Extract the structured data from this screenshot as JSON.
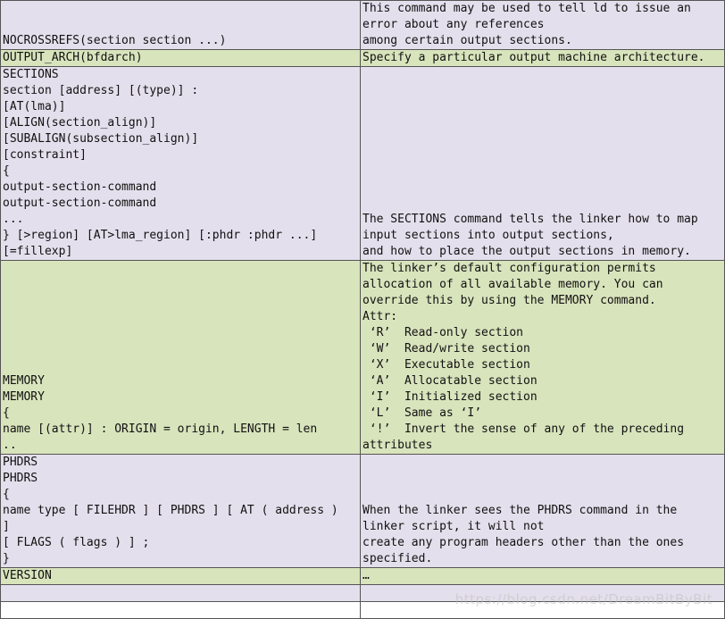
{
  "rows": [
    {
      "style": "lav",
      "height": 54,
      "left": [
        "NOCROSSREFS(section section ...)"
      ],
      "right": [
        "This command may be used to tell ld to issue an",
        "error about any references",
        "among certain output sections."
      ]
    },
    {
      "style": "grn",
      "height": 18,
      "left": [
        "OUTPUT_ARCH(bfdarch)"
      ],
      "right": [
        "Specify a particular output machine architecture."
      ]
    },
    {
      "style": "lav",
      "height": 216,
      "left": [
        "SECTIONS",
        "section [address] [(type)] :",
        "[AT(lma)]",
        "[ALIGN(section_align)]",
        "[SUBALIGN(subsection_align)]",
        "[constraint]",
        "{",
        "output-section-command",
        "output-section-command",
        "...",
        "} [>region] [AT>lma_region] [:phdr :phdr ...]",
        "[=fillexp]"
      ],
      "right": [
        "The SECTIONS command tells the linker how to map",
        "input sections into output sections,",
        "and how to place the output sections in memory."
      ]
    },
    {
      "style": "grn",
      "height": 216,
      "left": [
        "MEMORY",
        "MEMORY",
        "{",
        "name [(attr)] : ORIGIN = origin, LENGTH = len",
        ".."
      ],
      "right": [
        "The linker’s default configuration permits",
        "allocation of all available memory. You can",
        "override this by using the MEMORY command.",
        "Attr:",
        " ‘R’  Read-only section",
        " ‘W’  Read/write section",
        " ‘X’  Executable section",
        " ‘A’  Allocatable section",
        " ‘I’  Initialized section",
        " ‘L’  Same as ‘I’",
        " ‘!’  Invert the sense of any of the preceding",
        "attributes"
      ]
    },
    {
      "style": "lav",
      "height": 126,
      "left": [
        "PHDRS",
        "PHDRS",
        "{",
        "name type [ FILEHDR ] [ PHDRS ] [ AT ( address )",
        "]",
        "[ FLAGS ( flags ) ] ;",
        "}"
      ],
      "right": [
        "When the linker sees the PHDRS command in the",
        "linker script, it will not",
        "create any program headers other than the ones",
        "specified."
      ]
    },
    {
      "style": "grn",
      "height": 18,
      "left": [
        "VERSION"
      ],
      "right": [
        "…"
      ]
    },
    {
      "style": "lav",
      "height": 18,
      "left": [
        ""
      ],
      "right": [
        ""
      ]
    },
    {
      "style": "wht",
      "height": 18,
      "left": [
        ""
      ],
      "right": [
        ""
      ]
    }
  ],
  "watermark": "https://blog.csdn.net/DreamBitByBit"
}
